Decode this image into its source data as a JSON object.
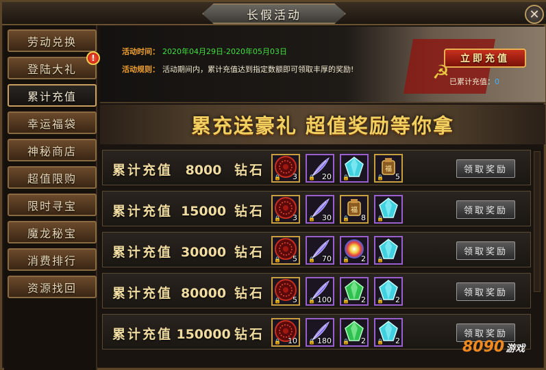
{
  "window": {
    "title": "长假活动"
  },
  "sidebar": {
    "items": [
      {
        "label": "劳动兑换"
      },
      {
        "label": "登陆大礼"
      },
      {
        "label": "累计充值"
      },
      {
        "label": "幸运福袋"
      },
      {
        "label": "神秘商店"
      },
      {
        "label": "超值限购"
      },
      {
        "label": "限时寻宝"
      },
      {
        "label": "魔龙秘宝"
      },
      {
        "label": "消费排行"
      },
      {
        "label": "资源找回"
      }
    ],
    "alert_badge": "!",
    "active_index": 2
  },
  "info": {
    "time_label": "活动时间：",
    "time_value": "2020年04月29日-2020年05月03日",
    "rule_label": "活动规则：",
    "rule_value": "活动期间内，累计充值达到指定数额即可领取丰厚的奖励!",
    "charge_button": "立即充值",
    "charged_label": "已累计充值：",
    "charged_value": "0"
  },
  "banner": {
    "text": "累充送豪礼   超值奖励等你拿"
  },
  "rows": [
    {
      "prefix": "累计充值",
      "amount": "8000",
      "unit": "钻石",
      "claim": "领取奖励",
      "items": [
        {
          "icon": "red-disc-icon",
          "count": "3"
        },
        {
          "icon": "feather-icon",
          "count": "20"
        },
        {
          "icon": "cyan-gem-icon",
          "count": ""
        },
        {
          "icon": "scroll-bag-icon",
          "count": "5"
        }
      ]
    },
    {
      "prefix": "累计充值",
      "amount": "15000",
      "unit": "钻石",
      "claim": "领取奖励",
      "items": [
        {
          "icon": "red-disc-icon",
          "count": "3"
        },
        {
          "icon": "feather-icon",
          "count": "30"
        },
        {
          "icon": "scroll-bag-icon",
          "count": "8"
        },
        {
          "icon": "cyan-gem-icon",
          "count": ""
        }
      ]
    },
    {
      "prefix": "累计充值",
      "amount": "30000",
      "unit": "钻石",
      "claim": "领取奖励",
      "items": [
        {
          "icon": "red-disc-icon",
          "count": "5"
        },
        {
          "icon": "feather-icon",
          "count": "70"
        },
        {
          "icon": "rainbow-orb-icon",
          "count": "2"
        },
        {
          "icon": "cyan-gem-icon",
          "count": ""
        }
      ]
    },
    {
      "prefix": "累计充值",
      "amount": "80000",
      "unit": "钻石",
      "claim": "领取奖励",
      "items": [
        {
          "icon": "red-disc-icon",
          "count": "5"
        },
        {
          "icon": "feather-icon",
          "count": "100"
        },
        {
          "icon": "green-gem-icon",
          "count": "2"
        },
        {
          "icon": "cyan-gem-icon",
          "count": "2"
        }
      ]
    },
    {
      "prefix": "累计充值",
      "amount": "150000",
      "unit": "钻石",
      "claim": "领取奖励",
      "items": [
        {
          "icon": "red-disc-icon",
          "count": "10"
        },
        {
          "icon": "feather-icon",
          "count": "180"
        },
        {
          "icon": "green-gem-icon",
          "count": "2"
        },
        {
          "icon": "cyan-gem-icon",
          "count": "2"
        }
      ]
    }
  ],
  "watermark": {
    "brand": "8090",
    "suffix": "游戏"
  },
  "colors": {
    "accent_gold": "#f2d060",
    "time_green": "#40e040",
    "charged_blue": "#40b0ff",
    "frame_brown": "#5a4528"
  }
}
